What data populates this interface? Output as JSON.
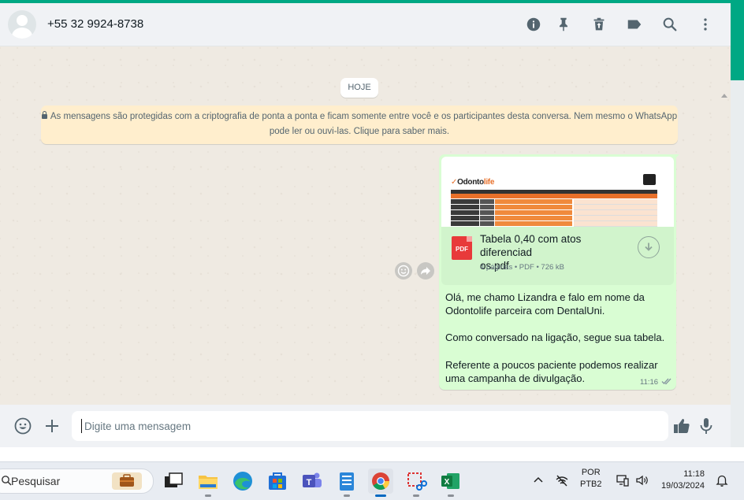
{
  "header": {
    "contact": "+55 32 9924-8738",
    "icons": [
      "info-icon",
      "pin-icon",
      "delete-icon",
      "label-icon",
      "search-icon",
      "menu-icon"
    ]
  },
  "chat": {
    "date_chip": "HOJE",
    "encryption_notice": "Às mensagens são protegidas com a criptografia de ponta a ponta e ficam somente entre você e os participantes desta conversa. Nem mesmo o WhatsApp pode ler ou ouvi-las. Clique para saber mais.",
    "encryption_line1": "As mensagens são protegidas com a criptografia de ponta a ponta e ficam somente entre você e os participantes desta conversa. Nem mesmo o WhatsApp",
    "encryption_line2": "pode ler ou ouvi-las. Clique para saber mais.",
    "message": {
      "document": {
        "thumb_logo": "Odonto",
        "thumb_logo_accent": "life",
        "file_name": "Tabela 0,40 com atos diferenciados.pdf",
        "file_name_line1": "Tabela 0,40 com atos diferenciad",
        "file_name_line2": "os.pdf",
        "file_type_label": "PDF",
        "meta": "4 páginas • PDF • 726 kB"
      },
      "paragraphs": [
        "Olá, me chamo Lizandra e falo em nome da Odontolife parceira com DentalUni.",
        "Como conversado na ligação, segue sua tabela.",
        "Referente a poucos paciente podemos realizar uma campanha de divulgação."
      ],
      "time": "11:16",
      "status": "delivered"
    }
  },
  "composer": {
    "placeholder": "Digite uma mensagem"
  },
  "taskbar": {
    "search_label": "Pesquisar",
    "apps": [
      "work-bag",
      "task-view",
      "file-explorer",
      "edge",
      "microsoft-store",
      "teams",
      "notepad",
      "chrome",
      "snipping-tool",
      "excel"
    ],
    "lang_top": "POR",
    "lang_bottom": "PTB2",
    "time": "11:18",
    "date": "19/03/2024"
  },
  "colors": {
    "accent": "#00a884",
    "outgoing_bubble": "#d9fdd3",
    "notice_bg": "#ffeecd",
    "chat_bg": "#efeae2"
  }
}
